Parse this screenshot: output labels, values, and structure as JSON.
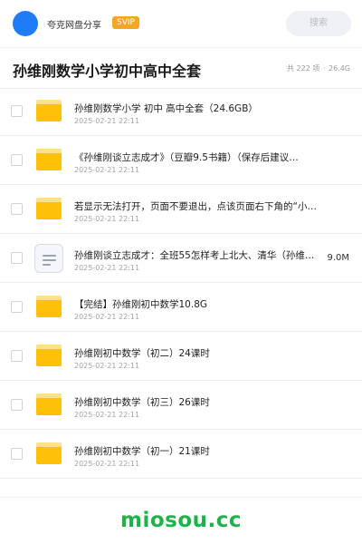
{
  "header": {
    "sharer_name": "夸克网盘分享",
    "badge": "SVIP",
    "search_label": "搜索"
  },
  "title_bar": {
    "title": "孙维刚数学小学初中高中全套",
    "count_text": "共 222 项",
    "separator": "·",
    "total_size": "26.4G"
  },
  "files": [
    {
      "name": "孙维刚数学小学 初中 高中全套（24.6GB）",
      "date": "2025-02-21 22:11",
      "type": "folder",
      "size": ""
    },
    {
      "name": "《孙维刚谈立志成才》（豆瓣9.5书籍）（保存后建议…",
      "date": "2025-02-21 22:11",
      "type": "folder",
      "size": ""
    },
    {
      "name": "若显示无法打开，页面不要退出，点该页面右下角的“小…",
      "date": "2025-02-21 22:11",
      "type": "folder",
      "size": ""
    },
    {
      "name": "孙维刚谈立志成才：全班55怎样考上北大、清华（孙维…",
      "date": "2025-02-21 22:11",
      "type": "document",
      "size": "9.0M"
    },
    {
      "name": "【完结】孙维刚初中数学10.8G",
      "date": "2025-02-21 22:11",
      "type": "folder",
      "size": ""
    },
    {
      "name": "孙维刚初中数学（初二）24课时",
      "date": "2025-02-21 22:11",
      "type": "folder",
      "size": ""
    },
    {
      "name": "孙维刚初中数学（初三）26课时",
      "date": "2025-02-21 22:11",
      "type": "folder",
      "size": ""
    },
    {
      "name": "孙维刚初中数学（初一）21课时",
      "date": "2025-02-21 22:11",
      "type": "folder",
      "size": ""
    }
  ],
  "footer": {
    "brand": "miosou.cc"
  },
  "colors": {
    "avatar": "#1f7cf7",
    "badge": "#f5a623",
    "folder": "#ffc107",
    "brand": "#21b14b"
  },
  "icons": {
    "folder": "folder-icon",
    "document": "document-icon"
  }
}
